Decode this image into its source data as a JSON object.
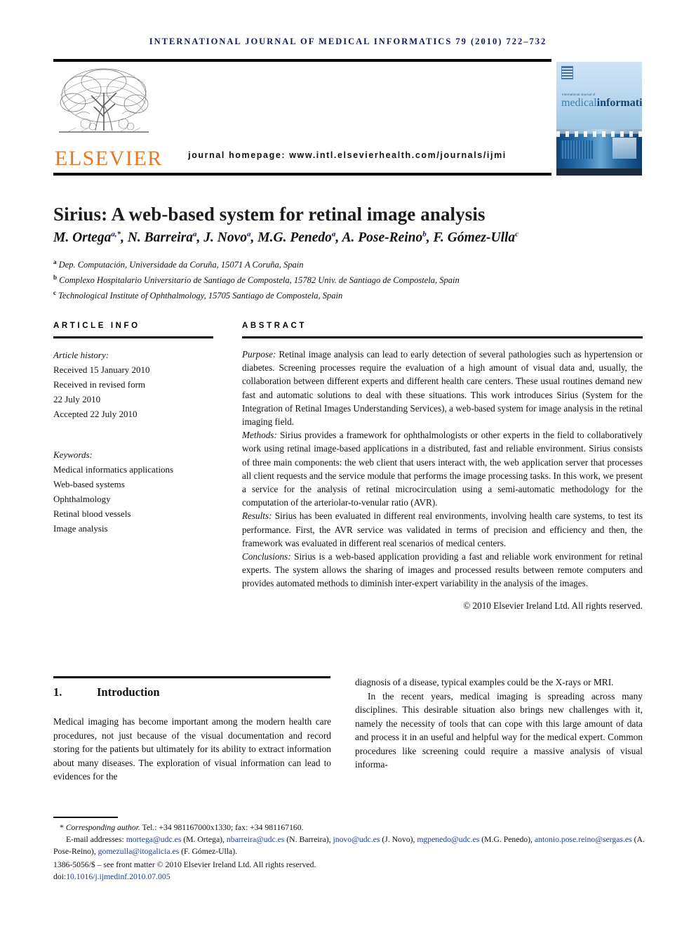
{
  "masthead": {
    "journal_line": "International Journal of Medical Informatics 79 (2010) 722–732",
    "homepage": "journal homepage: www.intl.elsevierhealth.com/journals/ijmi",
    "publisher": "ELSEVIER"
  },
  "cover": {
    "kicker": "International Journal of",
    "title_part1": "medical",
    "title_part2": "informatics"
  },
  "article": {
    "title": "Sirius: A web-based system for retinal image analysis",
    "authors": "M. Ortega, N. Barreira, J. Novo, M.G. Penedo, A. Pose-Reino, F. Gómez-Ulla",
    "author_list": [
      {
        "name": "M. Ortega",
        "sup": "a,*"
      },
      {
        "name": "N. Barreira",
        "sup": "a"
      },
      {
        "name": "J. Novo",
        "sup": "a"
      },
      {
        "name": "M.G. Penedo",
        "sup": "a"
      },
      {
        "name": "A. Pose-Reino",
        "sup": "b"
      },
      {
        "name": "F. Gómez-Ulla",
        "sup": "c"
      }
    ],
    "affiliations": [
      {
        "mark": "a",
        "text": "Dep. Computación, Universidade da Coruña, 15071 A Coruña, Spain"
      },
      {
        "mark": "b",
        "text": "Complexo Hospitalario Universitario de Santiago de Compostela, 15782 Univ. de Santiago de Compostela, Spain"
      },
      {
        "mark": "c",
        "text": "Technological Institute of Ophthalmology, 15705 Santiago de Compostela, Spain"
      }
    ]
  },
  "info": {
    "heading": "ARTICLE INFO",
    "history_label": "Article history:",
    "history": [
      "Received 15 January 2010",
      "Received in revised form",
      "22 July 2010",
      "Accepted 22 July 2010"
    ],
    "keywords_label": "Keywords:",
    "keywords": [
      "Medical informatics applications",
      "Web-based systems",
      "Ophthalmology",
      "Retinal blood vessels",
      "Image analysis"
    ]
  },
  "abstract": {
    "heading": "ABSTRACT",
    "purpose_label": "Purpose:",
    "purpose_text": " Retinal image analysis can lead to early detection of several pathologies such as hypertension or diabetes. Screening processes require the evaluation of a high amount of visual data and, usually, the collaboration between different experts and different health care centers. These usual routines demand new fast and automatic solutions to deal with these situations. This work introduces Sirius (System for the Integration of Retinal Images Understanding Services), a web-based system for image analysis in the retinal imaging field.",
    "methods_label": "Methods:",
    "methods_text": " Sirius provides a framework for ophthalmologists or other experts in the field to collaboratively work using retinal image-based applications in a distributed, fast and reliable environment. Sirius consists of three main components: the web client that users interact with, the web application server that processes all client requests and the service module that performs the image processing tasks. In this work, we present a service for the analysis of retinal microcirculation using a semi-automatic methodology for the computation of the arteriolar-to-venular ratio (AVR).",
    "results_label": "Results:",
    "results_text": " Sirius has been evaluated in different real environments, involving health care systems, to test its performance. First, the AVR service was validated in terms of precision and efficiency and then, the framework was evaluated in different real scenarios of medical centers.",
    "conclusions_label": "Conclusions:",
    "conclusions_text": " Sirius is a web-based application providing a fast and reliable work environment for retinal experts. The system allows the sharing of images and processed results between remote computers and provides automated methods to diminish inter-expert variability in the analysis of the images.",
    "copyright": "© 2010 Elsevier Ireland Ltd. All rights reserved."
  },
  "body": {
    "section_number": "1.",
    "section_title": "Introduction",
    "left_paragraph": "Medical imaging has become important among the modern health care procedures, not just because of the visual documentation and record storing for the patients but ultimately for its ability to extract information about many diseases. The exploration of visual information can lead to evidences for the",
    "right_paragraph_1": "diagnosis of a disease, typical examples could be the X-rays or MRI.",
    "right_paragraph_2": "In the recent years, medical imaging is spreading across many disciplines. This desirable situation also brings new challenges with it, namely the necessity of tools that can cope with this large amount of data and process it in an useful and helpful way for the medical expert. Common procedures like screening could require a massive analysis of visual informa-"
  },
  "footnotes": {
    "corresponding_label": "Corresponding author.",
    "corresponding_rest": " Tel.: +34 981167000x1330; fax: +34 981167160.",
    "email_label": "E-mail addresses:",
    "emails": [
      {
        "address": "mortega@udc.es",
        "person": " (M. Ortega), "
      },
      {
        "address": "nbarreira@udc.es",
        "person": " (N. Barreira), "
      },
      {
        "address": "jnovo@udc.es",
        "person": " (J. Novo), "
      },
      {
        "address": "mgpenedo@udc.es",
        "person": " (M.G. Penedo), "
      },
      {
        "address": "antonio.pose.reino@sergas.es",
        "person": " (A. Pose-Reino), "
      },
      {
        "address": "gomezulla@itogalicia.es",
        "person": " (F. Gómez-Ulla)."
      }
    ],
    "issn_line": "1386-5056/$ – see front matter © 2010 Elsevier Ireland Ltd. All rights reserved.",
    "doi_label": "doi:",
    "doi_value": "10.1016/j.ijmedinf.2010.07.005"
  }
}
